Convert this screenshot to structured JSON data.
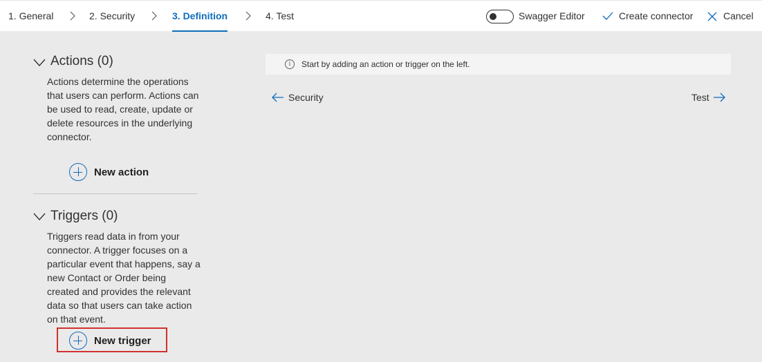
{
  "wizard": {
    "steps": [
      {
        "label": "1. General"
      },
      {
        "label": "2. Security"
      },
      {
        "label": "3. Definition"
      },
      {
        "label": "4. Test"
      }
    ],
    "active_step": 2
  },
  "toolbar": {
    "swagger_editor_label": "Swagger Editor",
    "swagger_editor_on": false,
    "create_connector_label": "Create connector",
    "cancel_label": "Cancel"
  },
  "actions": {
    "title": "Actions (0)",
    "description": "Actions determine the operations that users can perform. Actions can be used to read, create, update or delete resources in the underlying connector.",
    "new_label": "New action"
  },
  "triggers": {
    "title": "Triggers (0)",
    "description": "Triggers read data in from your connector. A trigger focuses on a particular event that happens, say a new Contact or Order being created and provides the relevant data so that users can take action on that event.",
    "new_label": "New trigger"
  },
  "info": {
    "icon": "i",
    "message": "Start by adding an action or trigger on the left."
  },
  "navigation": {
    "back_label": "Security",
    "next_label": "Test"
  },
  "colors": {
    "accent": "#0f6cbd",
    "highlight": "#d32f2f",
    "background": "#eaeaea"
  }
}
